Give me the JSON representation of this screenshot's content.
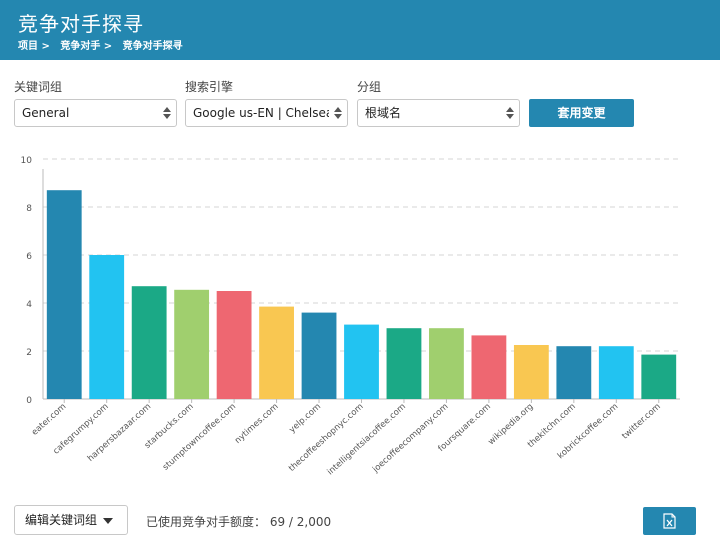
{
  "header": {
    "title": "竞争对手探寻",
    "breadcrumb": [
      "项目 >",
      "竞争对手 >",
      "竞争对手探寻"
    ]
  },
  "filters": {
    "keyword_group": {
      "label": "关键词组",
      "value": "General"
    },
    "search_engine": {
      "label": "搜索引擎",
      "value": "Google us-EN | Chelsea, New York"
    },
    "grouping": {
      "label": "分组",
      "value": "根域名"
    },
    "apply_label": "套用变更"
  },
  "chart_data": {
    "type": "bar",
    "categories": [
      "eater.com",
      "cafegrumpy.com",
      "harpersbazaar.com",
      "starbucks.com",
      "stumptowncoffee.com",
      "nytimes.com",
      "yelp.com",
      "thecoffeeshopnyc.com",
      "intelligentsiacoffee.com",
      "joecoffeecompany.com",
      "foursquare.com",
      "wikipedia.org",
      "thekitchn.com",
      "kobrickcoffee.com",
      "twitter.com"
    ],
    "values": [
      8.7,
      6.0,
      4.7,
      4.55,
      4.5,
      3.85,
      3.6,
      3.1,
      2.95,
      2.95,
      2.65,
      2.25,
      2.2,
      2.2,
      1.85
    ],
    "colors": [
      "#2487b0",
      "#22c3f1",
      "#1ba986",
      "#a0cf6e",
      "#ee6771",
      "#f9c751",
      "#2487b0",
      "#22c3f1",
      "#1ba986",
      "#a0cf6e",
      "#ee6771",
      "#f9c751",
      "#2487b0",
      "#22c3f1",
      "#1ba986"
    ],
    "yticks": [
      "0",
      "2",
      "4",
      "6",
      "8",
      "10"
    ],
    "ylim": [
      0,
      10
    ],
    "grid": true,
    "title": "",
    "xlabel": "",
    "ylabel": ""
  },
  "footer": {
    "edit_label": "编辑关键词组",
    "quota_label": "已使用竞争对手额度：",
    "quota_value": "69 / 2,000",
    "export_icon": "excel-export-icon"
  },
  "colors": {
    "brand": "#2487b0"
  }
}
